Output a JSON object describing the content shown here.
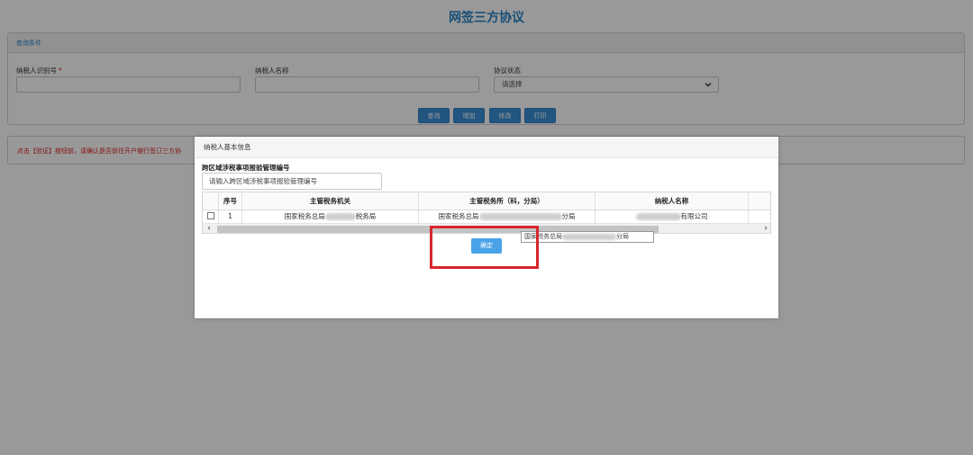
{
  "page": {
    "title": "网签三方协议"
  },
  "query": {
    "header": "查询条件",
    "taxpayer_id_label": "纳税人识别号",
    "required_mark": "*",
    "taxpayer_name_label": "纳税人名称",
    "status_label": "协议状态",
    "status_selected": "请选择"
  },
  "buttons": {
    "query": "查询",
    "add": "增加",
    "modify": "修改",
    "print": "打印"
  },
  "notice": {
    "text": "点击【验证】按钮前，请确认是否前往开户银行签订三方协"
  },
  "modal": {
    "title": "纳税人基本信息",
    "field_label": "跨区域涉税事项报验管理编号",
    "field_placeholder": "请输入跨区域涉税事项报验管理编号",
    "columns": [
      "序号",
      "主管税务机关",
      "主管税务所（科，分局）",
      "纳税人名称"
    ],
    "rows": [
      {
        "index": "1",
        "tax_authority_prefix": "国家税务总局",
        "tax_authority_suffix": "税务局",
        "tax_office_prefix": "国家税务总局",
        "tax_office_suffix": "分局",
        "taxpayer_name_suffix": "有限公司"
      }
    ],
    "tooltip_prefix": "国家税务总局",
    "tooltip_suffix": "分局",
    "confirm": "确定"
  },
  "colors": {
    "accent": "#2a86c8",
    "button": "#3a8fd6",
    "highlight": "#d8262d",
    "notice": "#e02020"
  }
}
